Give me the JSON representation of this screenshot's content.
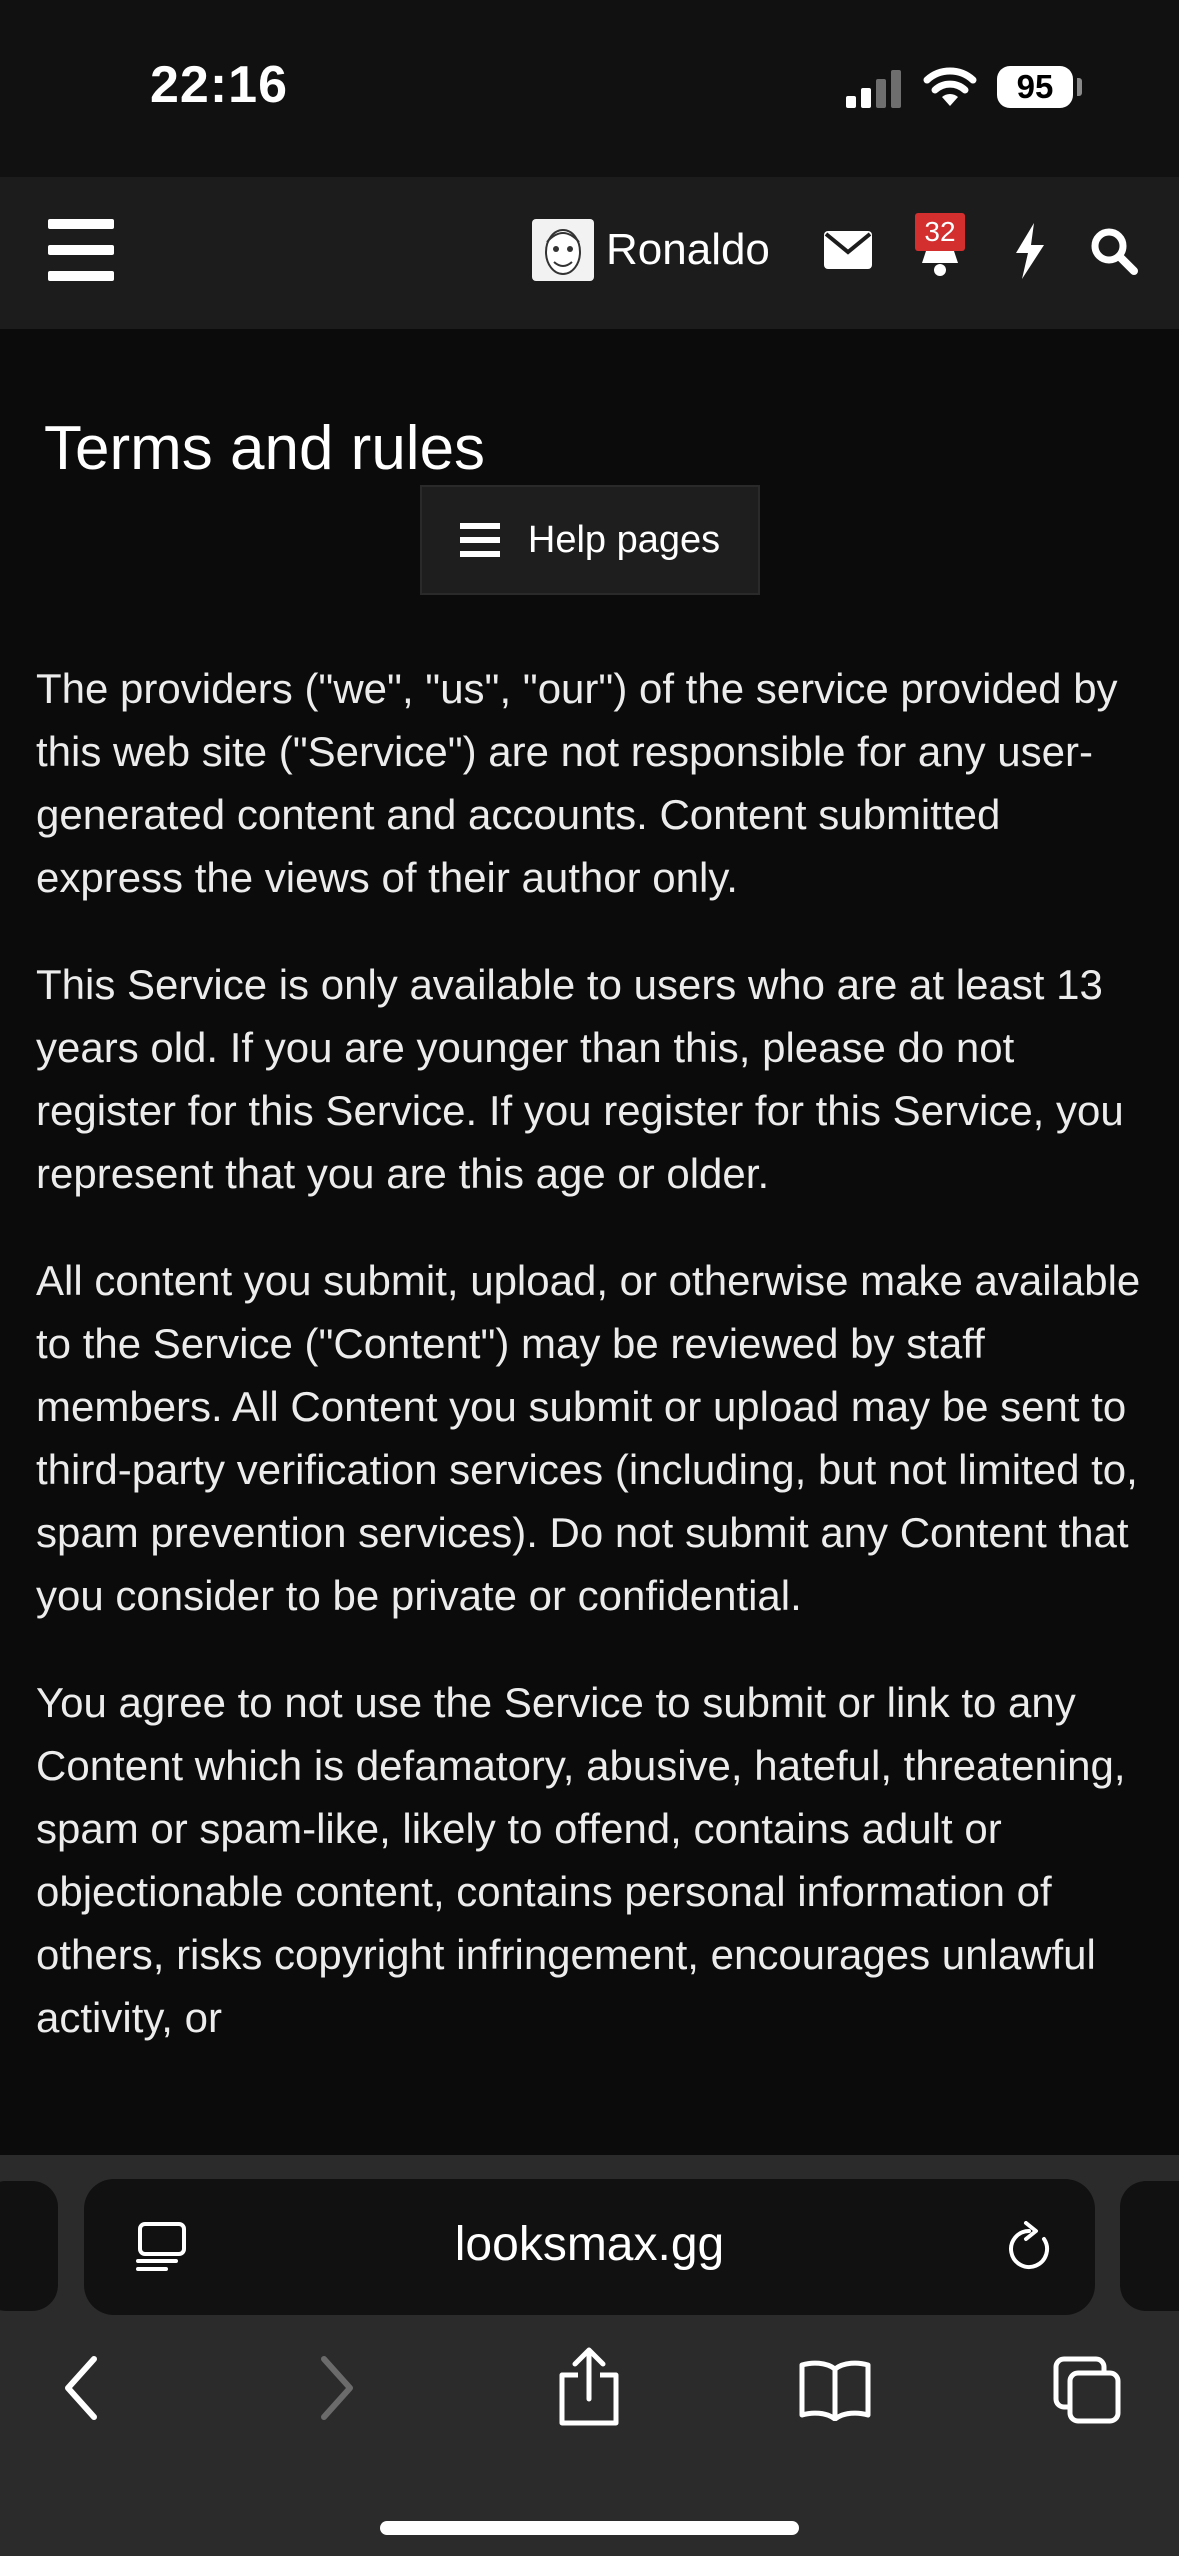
{
  "status_bar": {
    "time": "22:16",
    "battery": "95"
  },
  "header": {
    "username": "Ronaldo",
    "notification_count": "32",
    "icons": [
      "menu-icon",
      "mail-icon",
      "bell-icon",
      "bolt-icon",
      "search-icon"
    ]
  },
  "main": {
    "title": "Terms and rules",
    "help_button_label": "Help pages",
    "paragraphs": [
      "The providers (\"we\", \"us\", \"our\") of the service provided by this web site (\"Service\") are not responsible for any user-generated content and accounts. Content submitted express the views of their author only.",
      "This Service is only available to users who are at least 13 years old. If you are younger than this, please do not register for this Service. If you register for this Service, you represent that you are this age or older.",
      "All content you submit, upload, or otherwise make available to the Service (\"Content\") may be reviewed by staff members. All Content you submit or upload may be sent to third-party verification services (including, but not limited to, spam prevention services). Do not submit any Content that you consider to be private or confidential.",
      "You agree to not use the Service to submit or link to any Content which is defamatory, abusive, hateful, threatening, spam or spam-like, likely to offend, contains adult or objectionable content, contains personal information of others, risks copyright infringement, encourages unlawful activity, or"
    ]
  },
  "browser": {
    "url": "looksmax.gg",
    "icons": [
      "reader-icon",
      "reload-icon",
      "back-icon",
      "forward-icon",
      "share-icon",
      "bookmarks-icon",
      "tabs-icon"
    ]
  },
  "colors": {
    "background": "#0b0b0b",
    "header": "#1c1c1c",
    "badge": "#d32f2f",
    "toolbar": "#2b2b2b"
  }
}
